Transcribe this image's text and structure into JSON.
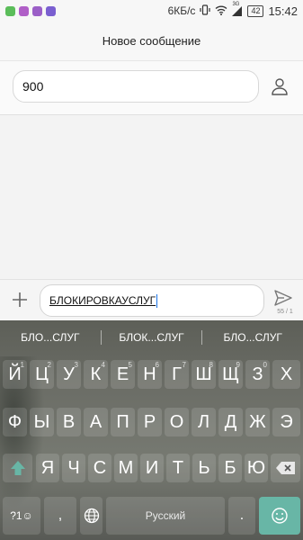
{
  "status_bar": {
    "speed": "6КБ/с",
    "network": "3G",
    "battery": "42",
    "time": "15:42",
    "notification_colors": [
      "#5bbd5a",
      "#b05fc7",
      "#9b5fc7",
      "#7a5fd0"
    ]
  },
  "header": {
    "title": "Новое сообщение"
  },
  "recipient": {
    "value": "900"
  },
  "compose": {
    "text": "БЛОКИРОВКАУСЛУГ",
    "char_count": "55 / 1"
  },
  "keyboard": {
    "suggestions": [
      "БЛО...СЛУГ",
      "БЛОК...СЛУГ",
      "БЛО...СЛУГ"
    ],
    "row1": [
      {
        "k": "Й",
        "h": "1"
      },
      {
        "k": "Ц",
        "h": "2"
      },
      {
        "k": "У",
        "h": "3"
      },
      {
        "k": "К",
        "h": "4"
      },
      {
        "k": "Е",
        "h": "5"
      },
      {
        "k": "Н",
        "h": "6"
      },
      {
        "k": "Г",
        "h": "7"
      },
      {
        "k": "Ш",
        "h": "8"
      },
      {
        "k": "Щ",
        "h": "9"
      },
      {
        "k": "З",
        "h": "0"
      },
      {
        "k": "Х",
        "h": ""
      }
    ],
    "row2": [
      "Ф",
      "Ы",
      "В",
      "А",
      "П",
      "Р",
      "О",
      "Л",
      "Д",
      "Ж",
      "Э"
    ],
    "row3": [
      "Я",
      "Ч",
      "С",
      "М",
      "И",
      "Т",
      "Ь",
      "Б",
      "Ю"
    ],
    "symbols_label": "?1☺",
    "comma": ",",
    "space_label": "Русский",
    "period": ".",
    "accent_color": "#68b6a6"
  }
}
